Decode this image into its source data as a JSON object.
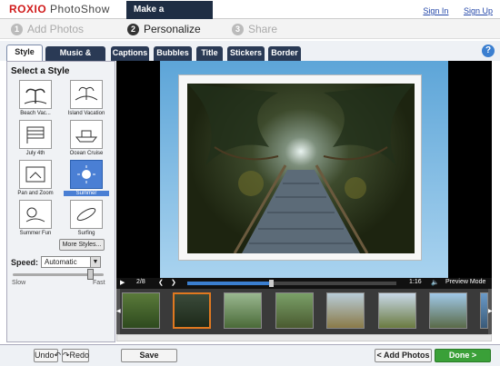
{
  "app": {
    "brand": "ROXIO",
    "product": "PhotoShow",
    "mode_tab": "Make a PhotoShow"
  },
  "links": {
    "sign_in": "Sign In",
    "sign_up": "Sign Up"
  },
  "steps": [
    {
      "num": "1",
      "label": "Add Photos",
      "active": false
    },
    {
      "num": "2",
      "label": "Personalize",
      "active": true
    },
    {
      "num": "3",
      "label": "Share",
      "active": false
    }
  ],
  "tabs": [
    "Style",
    "Music & Photos",
    "Captions",
    "Bubbles",
    "Title",
    "Stickers",
    "Border"
  ],
  "active_tab": "Style",
  "left": {
    "heading": "Select a Style",
    "styles": [
      {
        "label": "Beach Vac...",
        "icon": "beach-icon",
        "selected": false
      },
      {
        "label": "Island Vacation",
        "icon": "island-icon",
        "selected": false
      },
      {
        "label": "July 4th",
        "icon": "flag-icon",
        "selected": false
      },
      {
        "label": "Ocean Cruise",
        "icon": "ship-icon",
        "selected": false
      },
      {
        "label": "Pan and Zoom",
        "icon": "pan-zoom-icon",
        "selected": false
      },
      {
        "label": "Summer",
        "icon": "sun-icon",
        "selected": true
      },
      {
        "label": "Summer Fun",
        "icon": "summer-fun-icon",
        "selected": false
      },
      {
        "label": "Surfing",
        "icon": "surfboard-icon",
        "selected": false
      }
    ],
    "more_styles": "More Styles...",
    "speed_label": "Speed:",
    "speed_value": "Automatic",
    "slow": "Slow",
    "fast": "Fast"
  },
  "player": {
    "counter": "2/8",
    "time": "1:16",
    "preview_mode": "Preview Mode",
    "progress": 0.4
  },
  "filmstrip": {
    "count": 8,
    "selected_index": 1
  },
  "bottom": {
    "undo": "Undo",
    "redo": "Redo",
    "save": "Save",
    "add_photos": "< Add Photos",
    "done": "Done >"
  },
  "colors": {
    "accent": "#3b7fd0",
    "done_green": "#3aa038",
    "brand_red": "#d01a1a",
    "selected_thumb": "#e07820"
  }
}
